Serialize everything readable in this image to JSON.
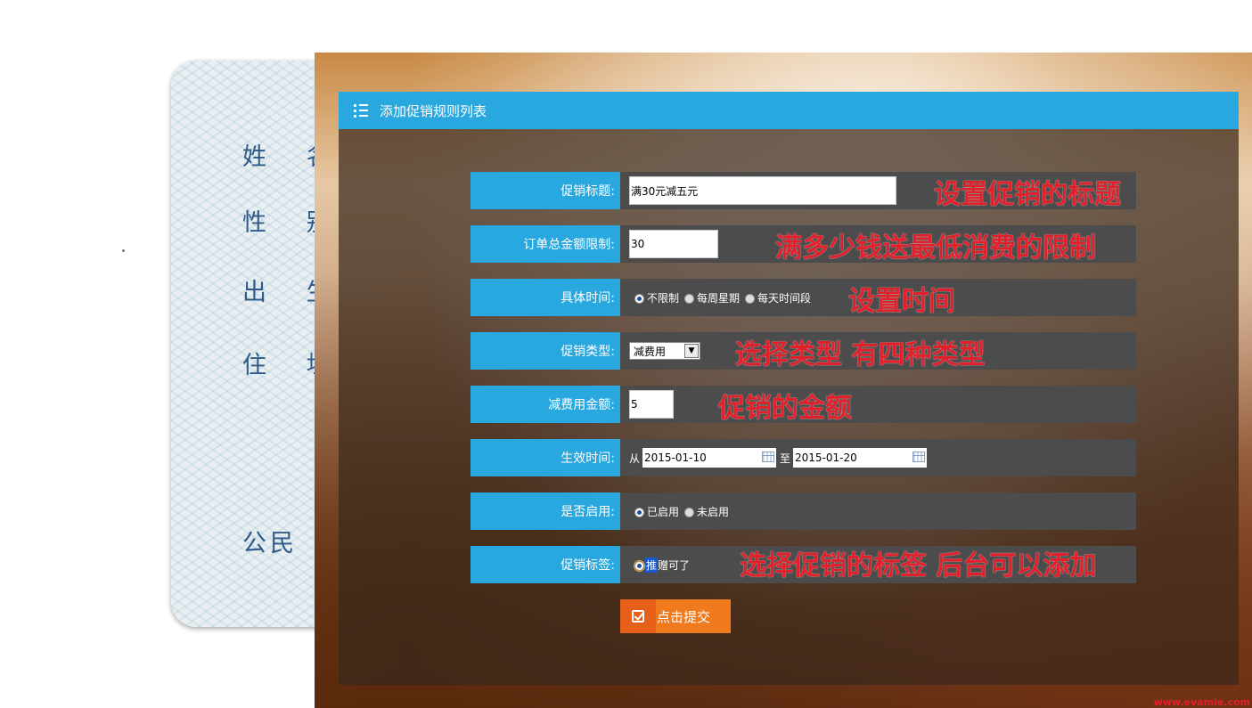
{
  "idcard": {
    "labels": [
      "姓 名",
      "性 别",
      "出 生",
      "住 址",
      "公民"
    ]
  },
  "panel": {
    "title": "添加促销规则列表"
  },
  "form": {
    "title_label": "促销标题:",
    "title_value": "满30元减五元",
    "amount_limit_label": "订单总金额限制:",
    "amount_limit_value": "30",
    "time_label": "具体时间:",
    "time_options": [
      "不限制",
      "每周星期",
      "每天时间段"
    ],
    "type_label": "促销类型:",
    "type_value": "减费用",
    "discount_label": "减费用金额:",
    "discount_value": "5",
    "effective_label": "生效时间:",
    "from_text": "从",
    "to_text": "至",
    "start_date": "2015-01-10",
    "end_date": "2015-01-20",
    "enabled_label": "是否启用:",
    "enabled_options": [
      "已启用",
      "未启用"
    ],
    "tag_label": "促销标签:",
    "tag_badge": "推",
    "tag_text": "赠可了",
    "submit_label": "点击提交"
  },
  "annotations": {
    "title": "设置促销的标题",
    "amount": "满多少钱送最低消费的限制",
    "time": "设置时间",
    "type": "选择类型 有四种类型",
    "discount": "促销的金额",
    "tag": "选择促销的标签 后台可以添加"
  },
  "watermark": "www.evamie.com",
  "colors": {
    "accent_blue": "#29a8e0",
    "row_gray": "#4c4c4c",
    "annotation_red": "#e0202a",
    "submit_orange": "#f07a1e"
  }
}
